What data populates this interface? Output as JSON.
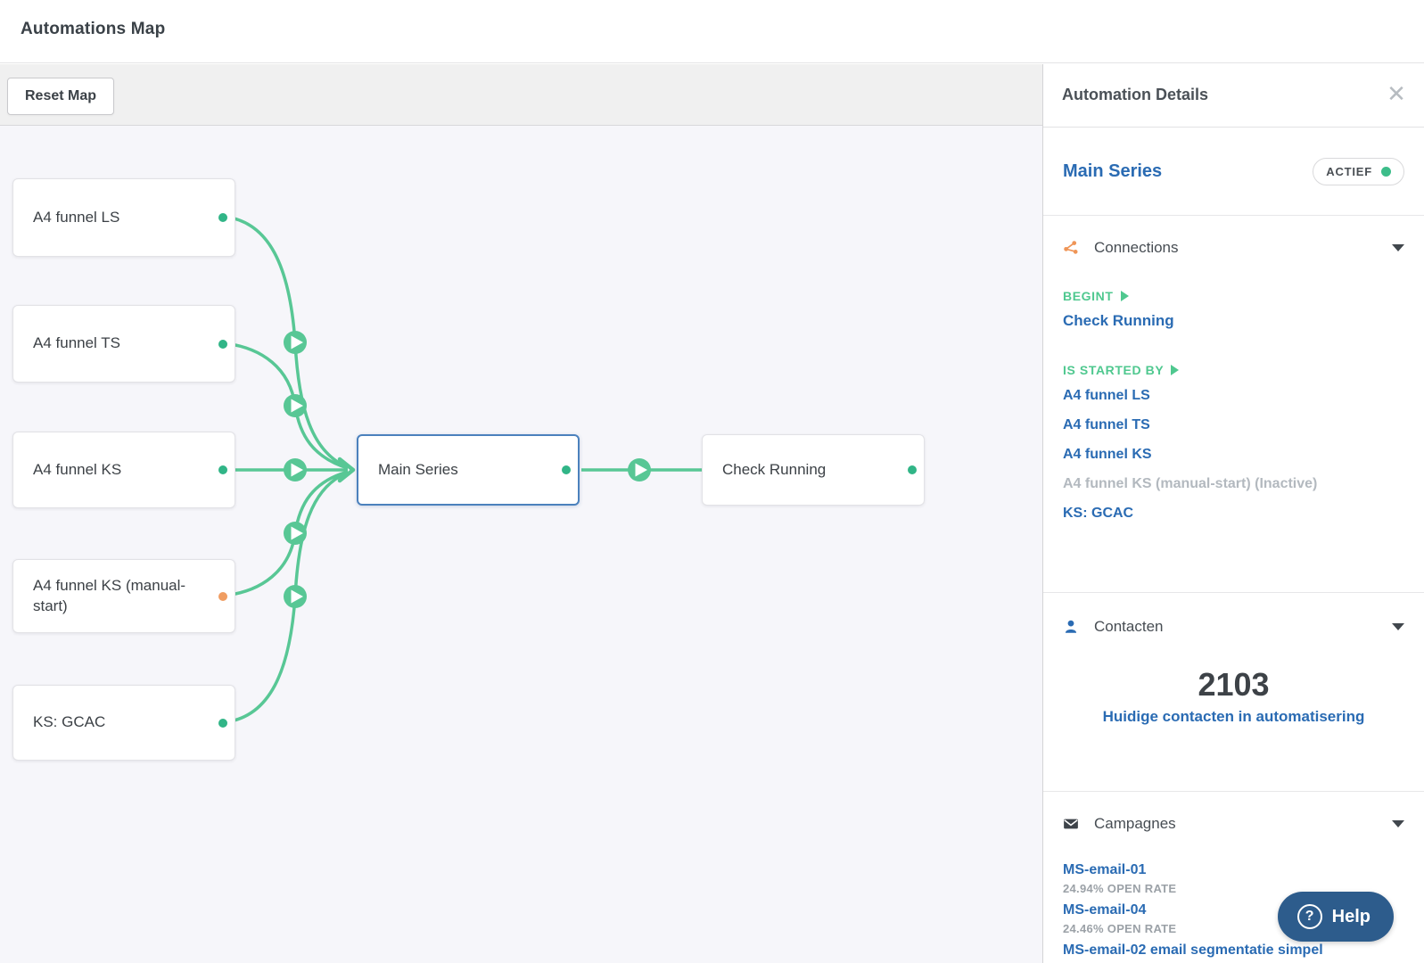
{
  "header": {
    "title": "Automations Map"
  },
  "toolbar": {
    "reset_label": "Reset Map"
  },
  "map": {
    "nodes": [
      {
        "label": "A4 funnel LS",
        "status": "active"
      },
      {
        "label": "A4 funnel TS",
        "status": "active"
      },
      {
        "label": "A4 funnel KS",
        "status": "active"
      },
      {
        "label": "A4 funnel KS (manual-start)",
        "status": "inactive"
      },
      {
        "label": "KS: GCAC",
        "status": "active"
      },
      {
        "label": "Main Series",
        "status": "active",
        "selected": true
      },
      {
        "label": "Check Running",
        "status": "active"
      }
    ]
  },
  "panel": {
    "title": "Automation Details",
    "automation": {
      "name": "Main Series",
      "status_label": "ACTIEF"
    },
    "connections": {
      "heading": "Connections",
      "begins_label": "BEGINT",
      "begins_items": [
        "Check Running"
      ],
      "started_by_label": "IS STARTED BY",
      "started_by_items": [
        "A4 funnel LS",
        "A4 funnel TS",
        "A4 funnel KS",
        "A4 funnel KS (manual-start) (Inactive)",
        "KS: GCAC"
      ]
    },
    "contacts": {
      "heading": "Contacten",
      "count": "2103",
      "caption": "Huidige contacten in automatisering"
    },
    "campaigns": {
      "heading": "Campagnes",
      "items": [
        {
          "name": "MS-email-01",
          "stat": "24.94% OPEN RATE"
        },
        {
          "name": "MS-email-04",
          "stat": "24.46% OPEN RATE"
        },
        {
          "name": "MS-email-02 email segmentatie simpel",
          "stat": ""
        }
      ]
    }
  },
  "help": {
    "label": "Help"
  },
  "colors": {
    "connector_green": "#58c795",
    "node_dot_green": "#31b587",
    "node_dot_orange": "#f09d62",
    "link_blue": "#2a6bb3",
    "group_label_green": "#4fc88f",
    "connections_icon_orange": "#ef9557",
    "selected_border_blue": "#4b81bd",
    "help_bg": "#2d5c8c"
  }
}
